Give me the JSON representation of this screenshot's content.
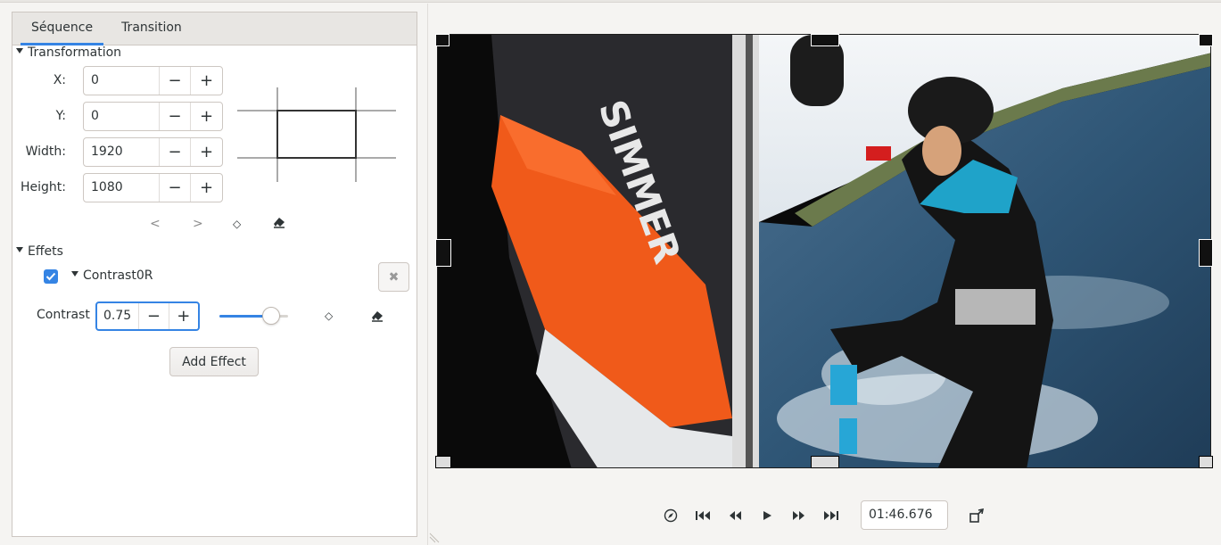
{
  "tabs": [
    {
      "label": "Séquence",
      "active": true
    },
    {
      "label": "Transition",
      "active": false
    }
  ],
  "transformation": {
    "title": "Transformation",
    "fields": [
      {
        "label": "X:",
        "value": "0"
      },
      {
        "label": "Y:",
        "value": "0"
      },
      {
        "label": "Width:",
        "value": "1920"
      },
      {
        "label": "Height:",
        "value": "1080"
      }
    ],
    "keyframe_controls": {
      "prev": "<",
      "next": ">",
      "add": "◇"
    }
  },
  "effects": {
    "title": "Effets",
    "effect_name": "Contrast0R",
    "enabled": true,
    "param_label": "Contrast",
    "param_value": "0.75",
    "slider_fraction": 0.75,
    "keyframe": "◇",
    "add_button": "Add Effect"
  },
  "player": {
    "timecode": "01:46.676"
  },
  "icons": {
    "minus": "−",
    "plus": "+",
    "accent": "#3584e4"
  }
}
